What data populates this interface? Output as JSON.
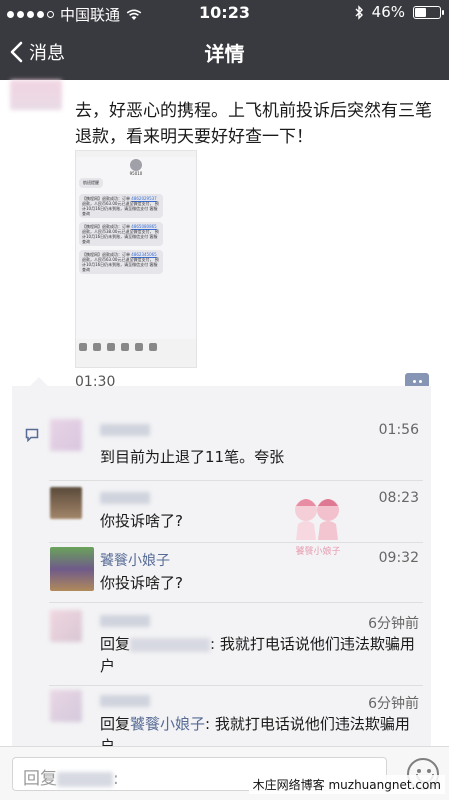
{
  "status_bar": {
    "carrier": "中国联通",
    "time": "10:23",
    "battery": "46%",
    "battery_level": 0.46
  },
  "nav": {
    "back_label": "消息",
    "title": "详情"
  },
  "post": {
    "text": "去，好恶心的携程。上飞机前投诉后突然有三笔退款，看来明天要好好查一下！",
    "time": "01:30",
    "screenshot": {
      "contact": "95010",
      "gray_label": "航班提醒",
      "sms": [
        {
          "head": "【携程网】退款成功：订单",
          "order": "4862029537",
          "body": "退款，人民币63.00元已退至微信支付，",
          "tail": "预计10月16日仍未到账，请至微信支付 客服查询"
        },
        {
          "head": "【携程网】退款成功：订单",
          "order": "4865080865",
          "body": "退款，人民币38.00元已退至微信支付，",
          "tail": "预计10月16日仍未到账，请至微信支付 客服查询"
        },
        {
          "head": "【携程网】退款成功：订单",
          "order": "4862345065",
          "body": "退款，人民币63.00元已退至微信支付，",
          "tail": "预计10月16日仍未到账，请至微信支付 客服查询"
        }
      ]
    }
  },
  "comments": [
    {
      "name": "",
      "time": "01:56",
      "text": "到目前为止退了11笔。夸张"
    },
    {
      "name": "",
      "time": "08:23",
      "text": "你投诉啥了?"
    },
    {
      "name": "饕餮小娘子",
      "time": "09:32",
      "text": "你投诉啥了?"
    },
    {
      "name": "",
      "time": "6分钟前",
      "reply_prefix": "回复",
      "reply_to": "",
      "text": ": 我就打电话说他们违法欺骗用户"
    },
    {
      "name": "",
      "time": "6分钟前",
      "reply_prefix": "回复",
      "reply_to": "饕餮小娘子",
      "text": ": 我就打电话说他们违法欺骗用户"
    }
  ],
  "watermark_doll_text": "饕餮小娘子",
  "reply_bar": {
    "placeholder_prefix": "回复",
    "placeholder_suffix": ":"
  },
  "site_watermark": "木庄网络博客 muzhuangnet.com",
  "colors": {
    "nav_bg": "#393a3f",
    "link_blue": "#576b95",
    "comment_bg": "#f3f3f5"
  }
}
